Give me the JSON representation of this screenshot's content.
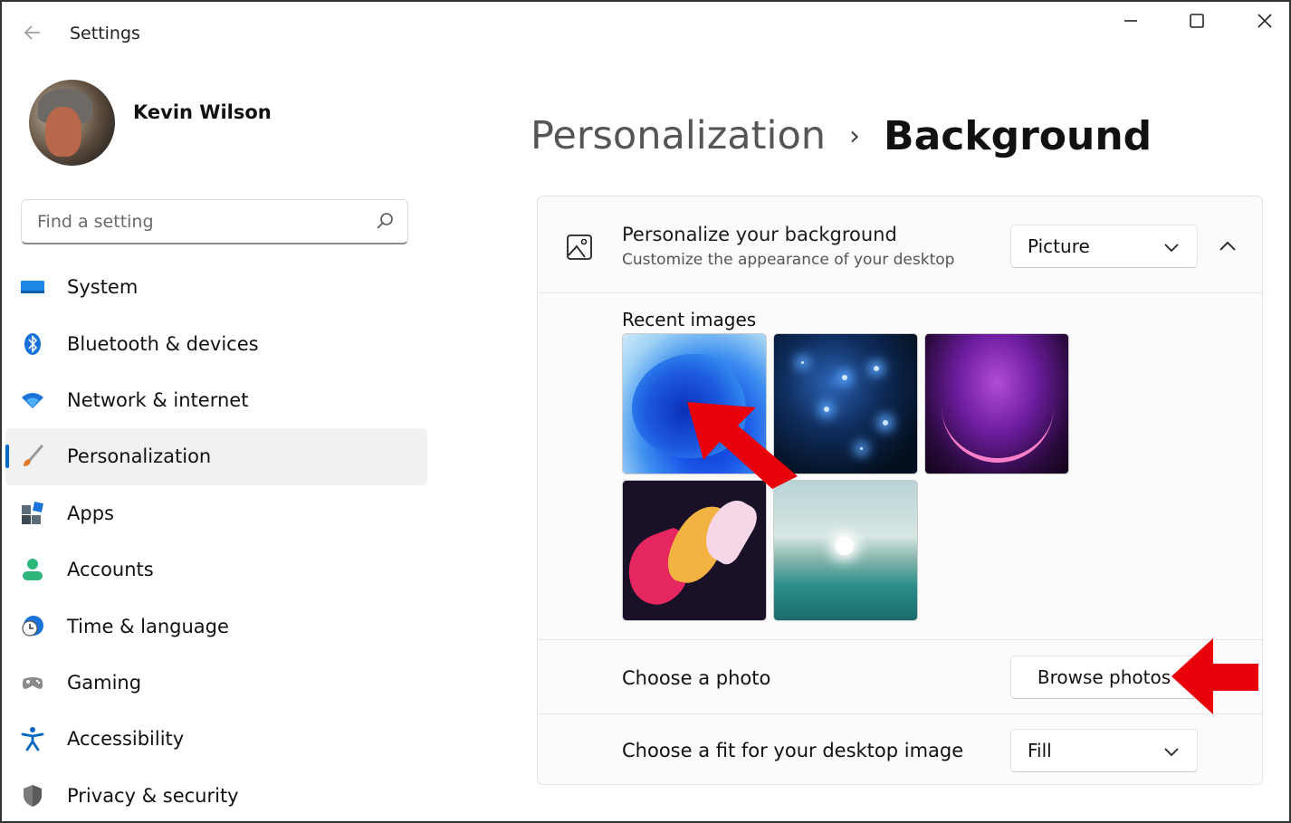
{
  "window": {
    "app_title": "Settings",
    "controls": {
      "minimize": "─",
      "maximize": "☐",
      "close": "✕"
    }
  },
  "user": {
    "name": "Kevin Wilson"
  },
  "search": {
    "placeholder": "Find a setting"
  },
  "sidebar": {
    "items": [
      {
        "label": "System",
        "icon": "system-icon",
        "color": "#0078d4"
      },
      {
        "label": "Bluetooth & devices",
        "icon": "bluetooth-icon",
        "color": "#0078d4"
      },
      {
        "label": "Network & internet",
        "icon": "wifi-icon",
        "color": "#1a73d9"
      },
      {
        "label": "Personalization",
        "icon": "paintbrush-icon",
        "color": "#d9762f",
        "active": true
      },
      {
        "label": "Apps",
        "icon": "apps-icon",
        "color": "#4a6d8c"
      },
      {
        "label": "Accounts",
        "icon": "accounts-icon",
        "color": "#2fb67a"
      },
      {
        "label": "Time & language",
        "icon": "clock-globe-icon",
        "color": "#1a73d9"
      },
      {
        "label": "Gaming",
        "icon": "gamepad-icon",
        "color": "#7a7a7a"
      },
      {
        "label": "Accessibility",
        "icon": "accessibility-icon",
        "color": "#0067c0"
      },
      {
        "label": "Privacy & security",
        "icon": "shield-icon",
        "color": "#6f6f6f"
      }
    ]
  },
  "breadcrumb": {
    "parent": "Personalization",
    "separator": "›",
    "current": "Background"
  },
  "background_card": {
    "title": "Personalize your background",
    "subtitle": "Customize the appearance of your desktop",
    "type_value": "Picture",
    "recent_label": "Recent images",
    "choose_photo_label": "Choose a photo",
    "browse_button": "Browse photos",
    "fit_label": "Choose a fit for your desktop image",
    "fit_value": "Fill"
  },
  "colors": {
    "accent": "#0067c0",
    "annotation_arrow": "#e8000b"
  }
}
